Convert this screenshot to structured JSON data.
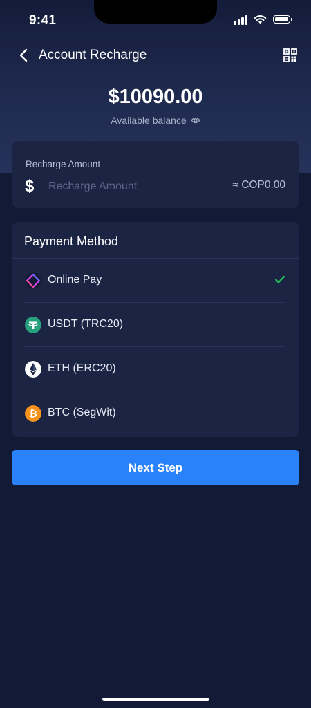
{
  "status_bar": {
    "time": "9:41"
  },
  "nav": {
    "title": "Account Recharge",
    "back_icon": "chevron-left-icon",
    "qr_icon": "qr-code-icon"
  },
  "balance": {
    "amount": "$10090.00",
    "caption": "Available balance",
    "eye_icon": "eye-icon"
  },
  "recharge": {
    "label": "Recharge Amount",
    "currency_symbol": "$",
    "placeholder": "Recharge Amount",
    "value": "",
    "converted": "≈ COP0.00"
  },
  "payment": {
    "header": "Payment Method",
    "methods": [
      {
        "label": "Online Pay",
        "icon": "online-pay-icon",
        "selected": true
      },
      {
        "label": "USDT (TRC20)",
        "icon": "usdt-icon",
        "selected": false
      },
      {
        "label": "ETH (ERC20)",
        "icon": "eth-icon",
        "selected": false
      },
      {
        "label": "BTC (SegWit)",
        "icon": "btc-icon",
        "selected": false
      }
    ]
  },
  "actions": {
    "next_label": "Next Step"
  },
  "colors": {
    "background": "#131a36",
    "card": "#1c2444",
    "accent": "#2a82fb",
    "check": "#22c55e",
    "usdt": "#26a17b",
    "btc": "#f7931a"
  }
}
